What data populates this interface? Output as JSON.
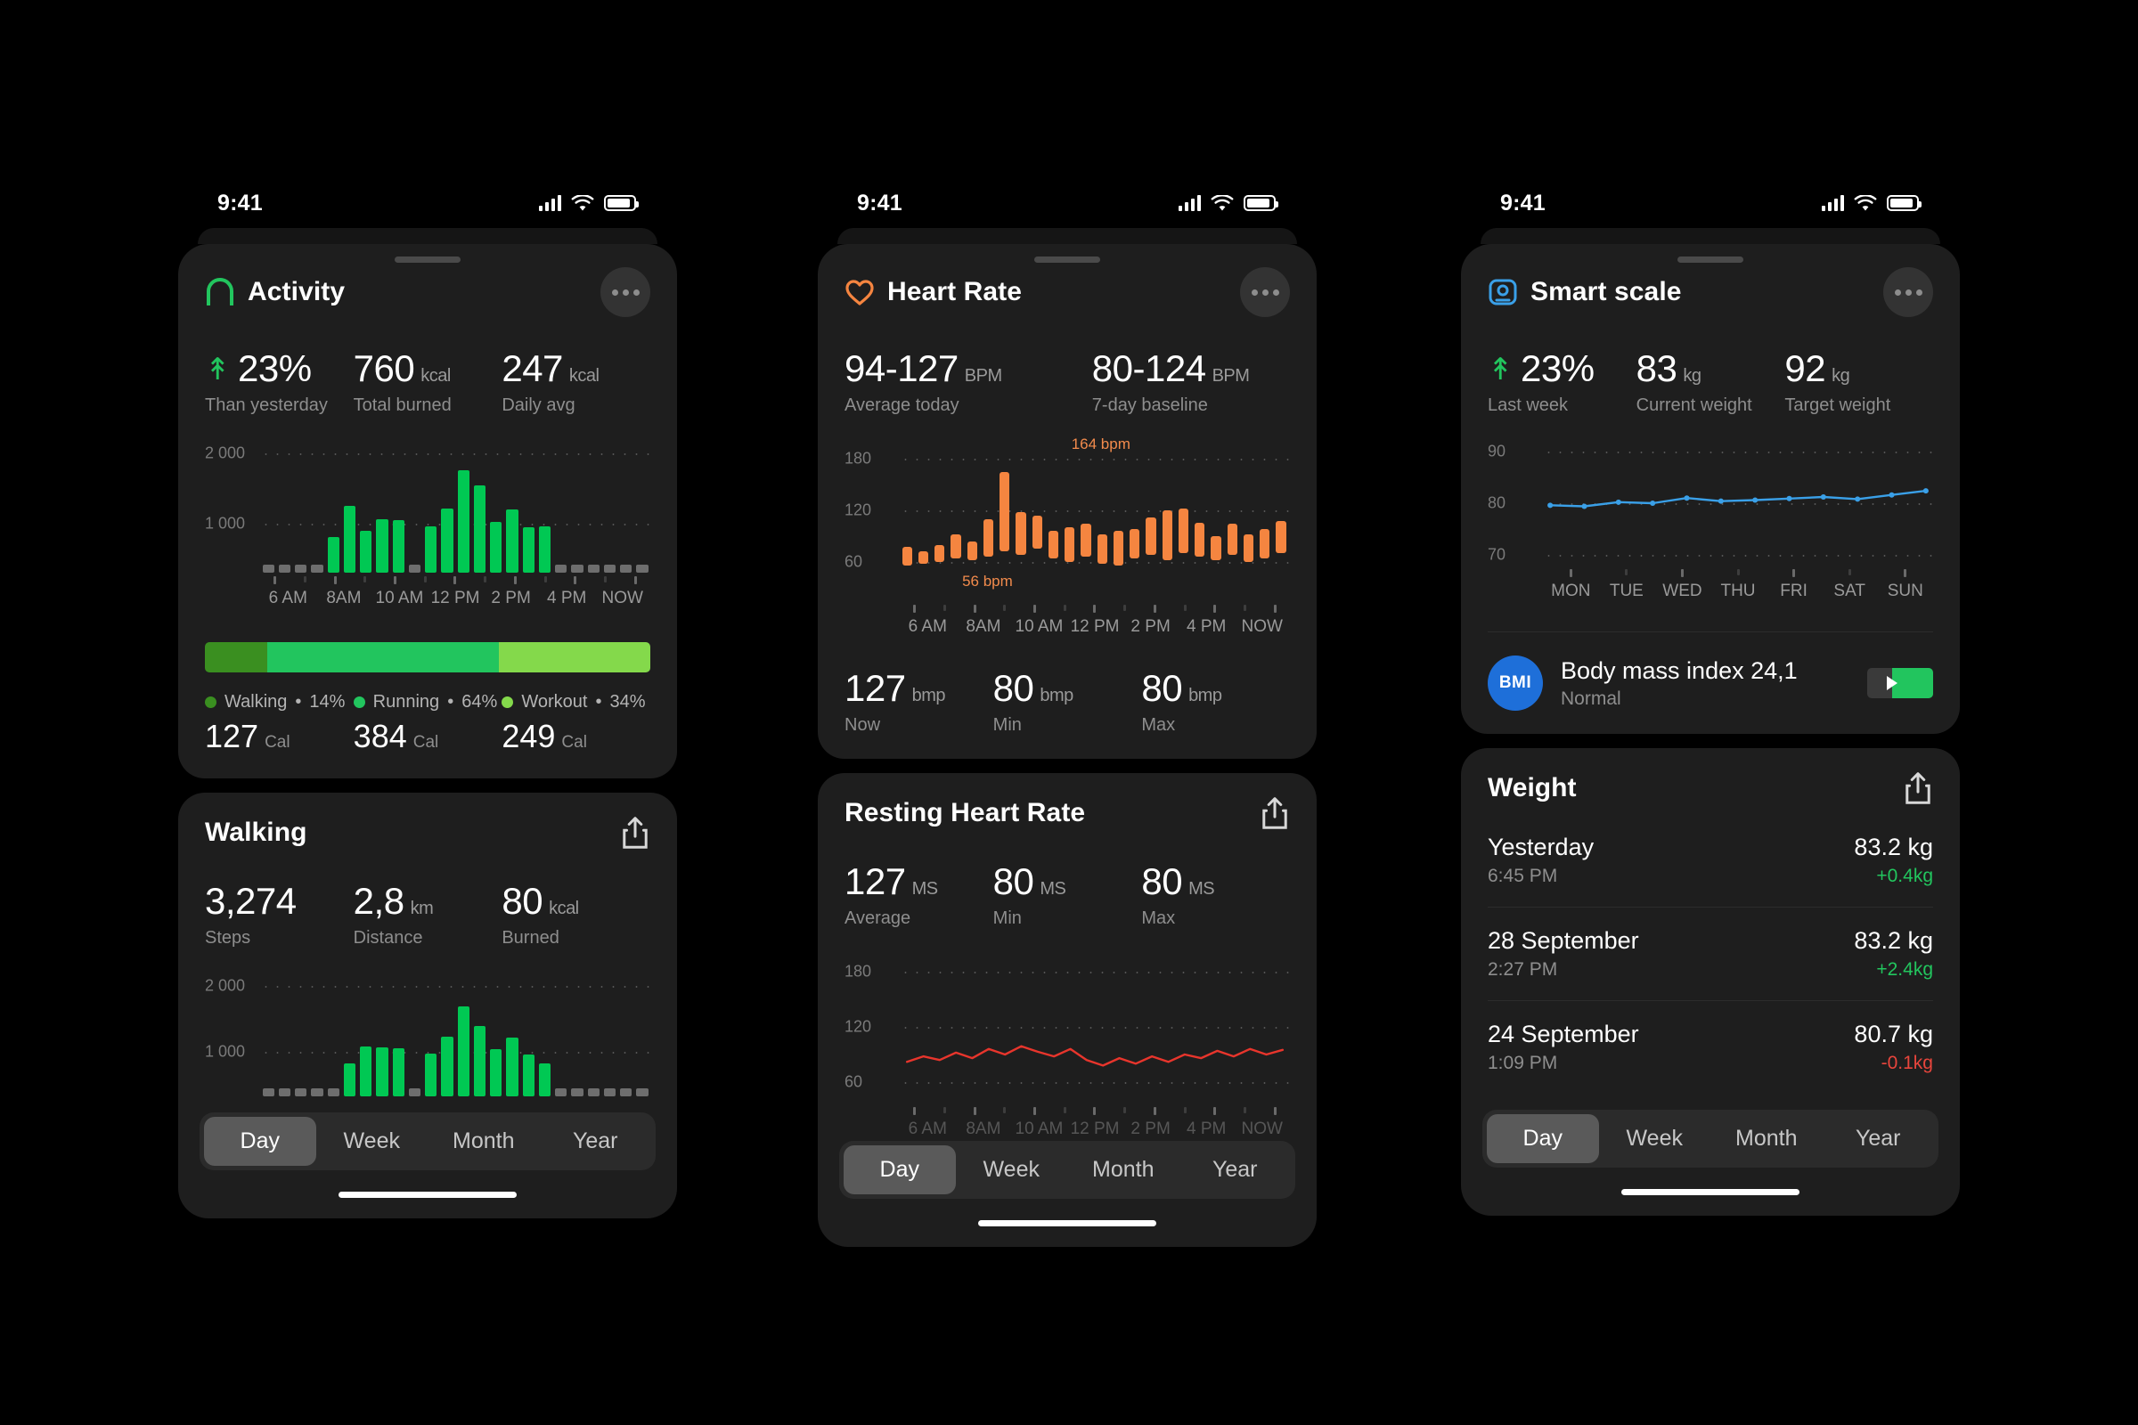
{
  "status_bar": {
    "time": "9:41",
    "signal_icon": "cellular-bars-icon",
    "wifi_icon": "wifi-icon",
    "battery_icon": "battery-icon"
  },
  "tabs": {
    "day": "Day",
    "week": "Week",
    "month": "Month",
    "year": "Year"
  },
  "activity": {
    "title": "Activity",
    "icon": "activity-arch-icon",
    "menu_icon": "more-options-icon",
    "stats": [
      {
        "value": "23%",
        "unit": "",
        "label": "Than yesterday",
        "arrow": "up-arrow-icon"
      },
      {
        "value": "760",
        "unit": "kcal",
        "label": "Total burned"
      },
      {
        "value": "247",
        "unit": "kcal",
        "label": "Daily avg"
      }
    ],
    "selected_tab": "Day",
    "legend": [
      {
        "name": "Walking",
        "pct": "14%",
        "cal": "127",
        "unit": "Cal",
        "color": "#3a8f20"
      },
      {
        "name": "Running",
        "pct": "64%",
        "cal": "384",
        "unit": "Cal",
        "color": "#22c55e"
      },
      {
        "name": "Workout",
        "pct": "34%",
        "cal": "249",
        "unit": "Cal",
        "color": "#84d94b"
      }
    ]
  },
  "walking": {
    "title": "Walking",
    "share_icon": "share-icon",
    "stats": [
      {
        "value": "3,274",
        "unit": "",
        "label": "Steps"
      },
      {
        "value": "2,8",
        "unit": "km",
        "label": "Distance"
      },
      {
        "value": "80",
        "unit": "kcal",
        "label": "Burned"
      }
    ],
    "selected_tab": "Day"
  },
  "heart_rate": {
    "title": "Heart Rate",
    "icon": "heart-icon",
    "menu_icon": "more-options-icon",
    "stats": [
      {
        "value": "94-127",
        "unit": "BPM",
        "label": "Average today"
      },
      {
        "value": "80-124",
        "unit": "BPM",
        "label": "7-day baseline"
      }
    ],
    "annotation_high": "164 bpm",
    "annotation_low": "56 bpm",
    "below_stats": [
      {
        "value": "127",
        "unit": "bmp",
        "label": "Now"
      },
      {
        "value": "80",
        "unit": "bmp",
        "label": "Min"
      },
      {
        "value": "80",
        "unit": "bmp",
        "label": "Max"
      }
    ]
  },
  "resting_heart_rate": {
    "title": "Resting Heart Rate",
    "share_icon": "share-icon",
    "stats": [
      {
        "value": "127",
        "unit": "MS",
        "label": "Average"
      },
      {
        "value": "80",
        "unit": "MS",
        "label": "Min"
      },
      {
        "value": "80",
        "unit": "MS",
        "label": "Max"
      }
    ],
    "selected_tab": "Day"
  },
  "smart_scale": {
    "title": "Smart scale",
    "icon": "scale-icon",
    "menu_icon": "more-options-icon",
    "stats": [
      {
        "value": "23%",
        "unit": "",
        "label": "Last week",
        "arrow": "up-arrow-icon"
      },
      {
        "value": "83",
        "unit": "kg",
        "label": "Current weight"
      },
      {
        "value": "92",
        "unit": "kg",
        "label": "Target weight"
      }
    ],
    "bmi": {
      "badge": "BMI",
      "title": "Body mass index 24,1",
      "status": "Normal",
      "gauge_icon": "bmi-gauge-icon"
    },
    "weight_section": {
      "title": "Weight",
      "share_icon": "share-icon"
    },
    "entries": [
      {
        "date": "Yesterday",
        "time": "6:45 PM",
        "weight": "83.2 kg",
        "delta": "+0.4kg",
        "delta_color": "#22c55e"
      },
      {
        "date": "28 September",
        "time": "2:27 PM",
        "weight": "83.2 kg",
        "delta": "+2.4kg",
        "delta_color": "#22c55e"
      },
      {
        "date": "24 September",
        "time": "1:09 PM",
        "weight": "80.7 kg",
        "delta": "-0.1kg",
        "delta_color": "#e8453c"
      }
    ],
    "selected_tab": "Day"
  },
  "chart_data": [
    {
      "type": "bar",
      "id": "activity-calories",
      "title": "Activity calories burned",
      "ylabel": "",
      "xlabel": "",
      "yticks": [
        "1 000",
        "2 000"
      ],
      "ylim": [
        0,
        2400
      ],
      "xlabels": [
        "6 AM",
        "8AM",
        "10 AM",
        "12 PM",
        "2 PM",
        "4 PM",
        "NOW"
      ],
      "color_active": "#00c853",
      "color_inactive": "#6e6e6e",
      "values": [
        60,
        60,
        60,
        60,
        700,
        1300,
        820,
        1050,
        1020,
        60,
        900,
        1260,
        2000,
        1700,
        1000,
        1240,
        880,
        900,
        60,
        60,
        60,
        60,
        60,
        60
      ]
    },
    {
      "type": "bar",
      "id": "walking-steps",
      "title": "Walking steps",
      "yticks": [
        "1 000",
        "2 000"
      ],
      "ylim": [
        0,
        2400
      ],
      "xlabels": [],
      "color_active": "#00c853",
      "color_inactive": "#6e6e6e",
      "values": [
        60,
        60,
        60,
        60,
        60,
        700,
        1050,
        1040,
        1020,
        60,
        900,
        1260,
        1900,
        1480,
        1000,
        1240,
        880,
        700,
        60,
        60,
        60,
        60,
        60,
        60
      ]
    },
    {
      "type": "bar",
      "id": "heart-rate-range",
      "title": "Heart rate today",
      "yticks": [
        "60",
        "120",
        "180"
      ],
      "ylim": [
        40,
        190
      ],
      "xlabels": [
        "6 AM",
        "8AM",
        "10 AM",
        "12 PM",
        "2 PM",
        "4 PM",
        "NOW"
      ],
      "color": "#f58540",
      "annotation_high": "164 bpm",
      "annotation_low": "56 bpm",
      "ranges": [
        [
          56,
          78
        ],
        [
          58,
          72
        ],
        [
          60,
          80
        ],
        [
          64,
          92
        ],
        [
          62,
          84
        ],
        [
          66,
          110
        ],
        [
          72,
          164
        ],
        [
          68,
          118
        ],
        [
          76,
          114
        ],
        [
          64,
          96
        ],
        [
          60,
          100
        ],
        [
          66,
          104
        ],
        [
          58,
          92
        ],
        [
          56,
          96
        ],
        [
          64,
          98
        ],
        [
          68,
          112
        ],
        [
          62,
          120
        ],
        [
          70,
          122
        ],
        [
          66,
          106
        ],
        [
          62,
          90
        ],
        [
          68,
          104
        ],
        [
          60,
          92
        ],
        [
          64,
          98
        ],
        [
          70,
          108
        ]
      ]
    },
    {
      "type": "line",
      "id": "resting-heart-rate",
      "title": "Resting heart rate",
      "yticks": [
        "60",
        "120",
        "180"
      ],
      "ylim": [
        40,
        190
      ],
      "color": "#e8352c",
      "values": [
        82,
        88,
        84,
        92,
        86,
        96,
        90,
        99,
        93,
        88,
        96,
        84,
        78,
        86,
        80,
        88,
        82,
        90,
        86,
        94,
        88,
        96,
        90,
        95
      ]
    },
    {
      "type": "line",
      "id": "smart-scale-weight",
      "title": "Weight over the week",
      "yticks": [
        "70",
        "80",
        "90"
      ],
      "ylim": [
        65,
        92
      ],
      "xlabels": [
        "MON",
        "TUE",
        "WED",
        "THU",
        "FRI",
        "SAT",
        "SUN"
      ],
      "color": "#3aa0e8",
      "values": [
        79.6,
        79.4,
        80.2,
        80.0,
        81.0,
        80.4,
        80.6,
        80.9,
        81.2,
        80.8,
        81.6,
        82.4
      ]
    }
  ]
}
